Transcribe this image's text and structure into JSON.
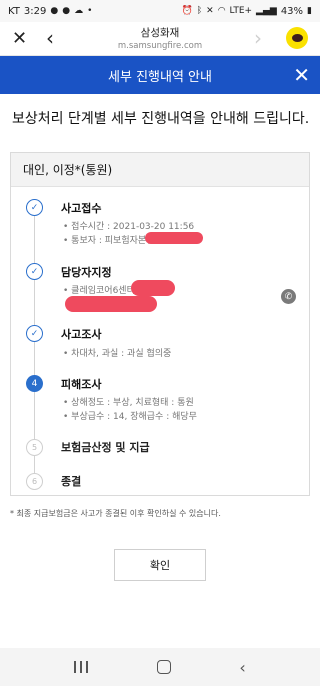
{
  "status_bar": {
    "carrier": "KT",
    "time": "3:29",
    "left_icons": [
      "chat-icon",
      "chat-icon",
      "cloud-icon",
      "dot-icon"
    ],
    "right_icons": [
      "alarm-icon",
      "bluetooth-icon",
      "mute-icon",
      "wifi-icon"
    ],
    "network": "LTE+",
    "battery": "43%"
  },
  "browser": {
    "site_title": "삼성화재",
    "url": "m.samsungfire.com"
  },
  "header": {
    "title": "세부 진행내역 안내"
  },
  "intro_text": "보상처리 단계별 세부 진행내역을 안내해 드립니다.",
  "card": {
    "title": "대인, 이정*(통원)",
    "steps": [
      {
        "number": "1",
        "status": "done",
        "title": "사고접수",
        "details": [
          "접수시간 : 2021-03-20 11:56",
          "통보자 : 피보험자본인"
        ]
      },
      {
        "number": "2",
        "status": "done",
        "title": "담당자지정",
        "details": [
          "클레임코어6센터"
        ]
      },
      {
        "number": "3",
        "status": "done",
        "title": "사고조사",
        "details": [
          "차대차, 과실 : 과실 협의중"
        ]
      },
      {
        "number": "4",
        "status": "current",
        "title": "피해조사",
        "details": [
          "상해정도 : 부상, 치료형태 : 통원",
          "부상급수 : 14, 장해급수 : 해당무"
        ]
      },
      {
        "number": "5",
        "status": "todo",
        "title": "보험금산정 및 지급",
        "details": []
      },
      {
        "number": "6",
        "status": "todo",
        "title": "종결",
        "details": []
      }
    ]
  },
  "footnote": "* 최종 지급보험금은 사고가 종결된 이후 확인하실 수 있습니다.",
  "confirm_label": "확인",
  "colors": {
    "header_blue": "#1a53c5",
    "step_blue": "#2a6fcc",
    "redaction": "#ef4a5e",
    "kakao_yellow": "#fae100"
  }
}
